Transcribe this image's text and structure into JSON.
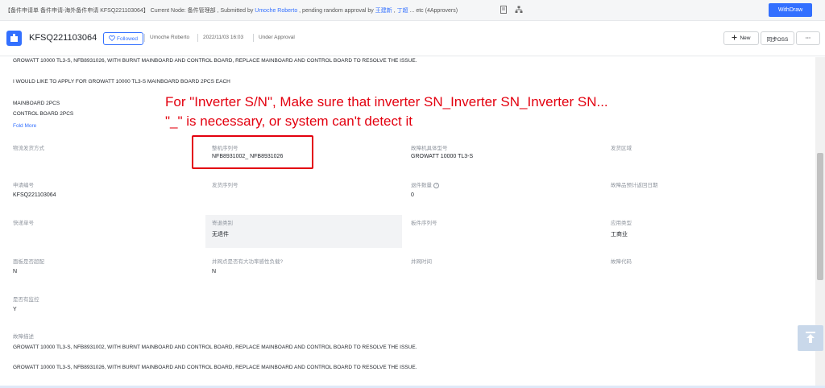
{
  "topbar": {
    "breadcrumb": "【备件申请单 备件申请-海外备件申请 KFSQ221103064】 Current Node: 备件管理部 , Submitted by",
    "submitter": "Umoche Roberto",
    "pending_text": ", pending random approval by",
    "approver1": "王建新",
    "approver2": "丁超",
    "etc_text": "... etc (4Approvers)",
    "withdraw_label": "WithDraw"
  },
  "header": {
    "title": "KFSQ221103064",
    "follow_label": "Followed",
    "submitter": "Umoche Roberto",
    "datetime": "2022/11/03 16:03",
    "status": "Under Approval",
    "new_label": "New",
    "sync_label": "同步OSS",
    "more_label": "···"
  },
  "content": {
    "para_top": "GROWATT 10000 TL3-S, NFB8931026, WITH BURNT MAINBOARD AND CONTROL BOARD, REPLACE  MAINBOARD AND CONTROL BOARD TO RESOLVE THE ISSUE.",
    "para_apply": "I WOULD LIKE TO APPLY FOR GROWATT 10000 TL3-S MAINBOARD BOARD 2PCS EACH",
    "item1": "MAINBOARD 2PCS",
    "item2": "CONTROL BOARD 2PCS",
    "fold_label": "Fold More",
    "annotation_line1": "For \"Inverter S/N\", Make sure that inverter SN_Inverter SN_Inverter SN...",
    "annotation_line2": "\"_\" is necessary, or system can't detect it",
    "fields": {
      "logistics_label": "物流发货方式",
      "sn_label": "整机序列号",
      "sn_value": "NFB8931002_ NFB8931026",
      "model_label": "故障机具体型号",
      "model_value": "GROWATT 10000 TL3-S",
      "region_label": "发货区域",
      "appno_label": "申请编号",
      "appno_value": "KFSQ221103064",
      "ship_sn_label": "发货序列号",
      "return_qty_label": "退件数量",
      "return_qty_value": "0",
      "return_date_label": "故障品预计返回日期",
      "express_label": "快递单号",
      "return_type_label": "寄退类别",
      "return_type_value": "无退件",
      "board_sn_label": "板件序列号",
      "app_type_label": "应用类型",
      "app_type_value": "工商业",
      "panel_label": "面板是否超配",
      "panel_value": "N",
      "grid_load_label": "并网点是否有大功率感性负载?",
      "grid_load_value": "N",
      "grid_time_label": "并网时间",
      "fault_code_label": "故障代码",
      "monitor_label": "是否有监控",
      "monitor_value": "Y",
      "desc_label": "故障描述",
      "desc_line1": "GROWATT 10000 TL3-S, NFB8931002, WITH BURNT MAINBOARD AND CONTROL BOARD, REPLACE MAINBOARD AND CONTROL BOARD TO RESOLVE THE ISSUE.",
      "desc_line2": "GROWATT 10000 TL3-S, NFB8931026, WITH BURNT MAINBOARD AND CONTROL BOARD, REPLACE  MAINBOARD AND CONTROL BOARD TO RESOLVE THE ISSUE."
    }
  }
}
